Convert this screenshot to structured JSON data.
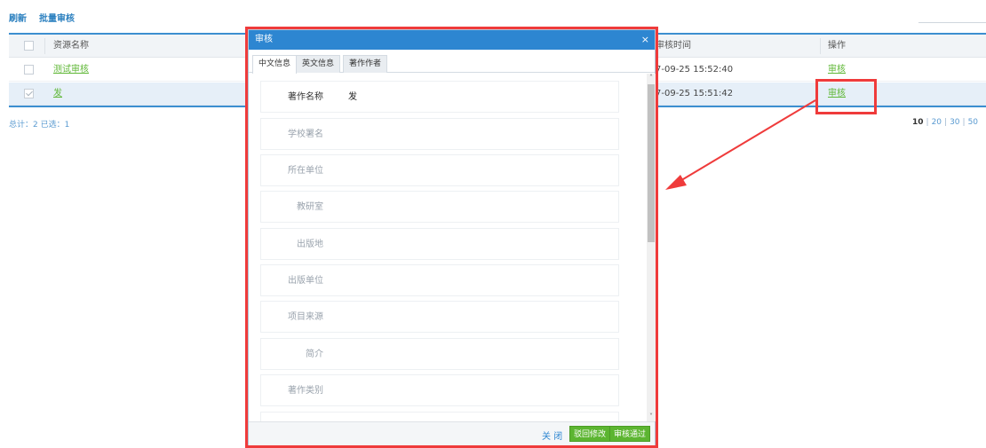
{
  "toolbar": {
    "refresh_label": "刷新",
    "batch_review_label": "批量审核"
  },
  "table": {
    "columns": {
      "name": "资源名称",
      "review_time": "审核时间",
      "action": "操作"
    },
    "rows": [
      {
        "name": "测试审核",
        "review_time": "7-09-25 15:52:40",
        "action": "审核",
        "selected": false
      },
      {
        "name": "发",
        "review_time": "7-09-25 15:51:42",
        "action": "审核",
        "selected": true
      }
    ]
  },
  "summary": "总计：2 已选：1",
  "pager": {
    "current": "10",
    "options": [
      "20",
      "30",
      "50"
    ]
  },
  "dialog": {
    "title": "审核",
    "close_glyph": "×",
    "tabs": [
      "中文信息",
      "英文信息",
      "著作作者"
    ],
    "active_tab": "中文信息",
    "fields": [
      {
        "label": "著作名称",
        "value": "发"
      },
      {
        "label": "学校署名",
        "value": ""
      },
      {
        "label": "所在单位",
        "value": ""
      },
      {
        "label": "教研室",
        "value": ""
      },
      {
        "label": "出版地",
        "value": ""
      },
      {
        "label": "出版单位",
        "value": ""
      },
      {
        "label": "项目来源",
        "value": ""
      },
      {
        "label": "简介",
        "value": ""
      },
      {
        "label": "著作类别",
        "value": ""
      },
      {
        "label": "",
        "value": ""
      }
    ],
    "footer": {
      "close_label": "关 闭",
      "return_label": "驳回修改",
      "pass_label": "审核通过"
    }
  },
  "colors": {
    "accent_blue": "#2d86d1",
    "link_green": "#5fb736",
    "action_green": "#5cb531",
    "annotation_red": "#ef3b3b",
    "selected_row": "#e6eff8"
  }
}
